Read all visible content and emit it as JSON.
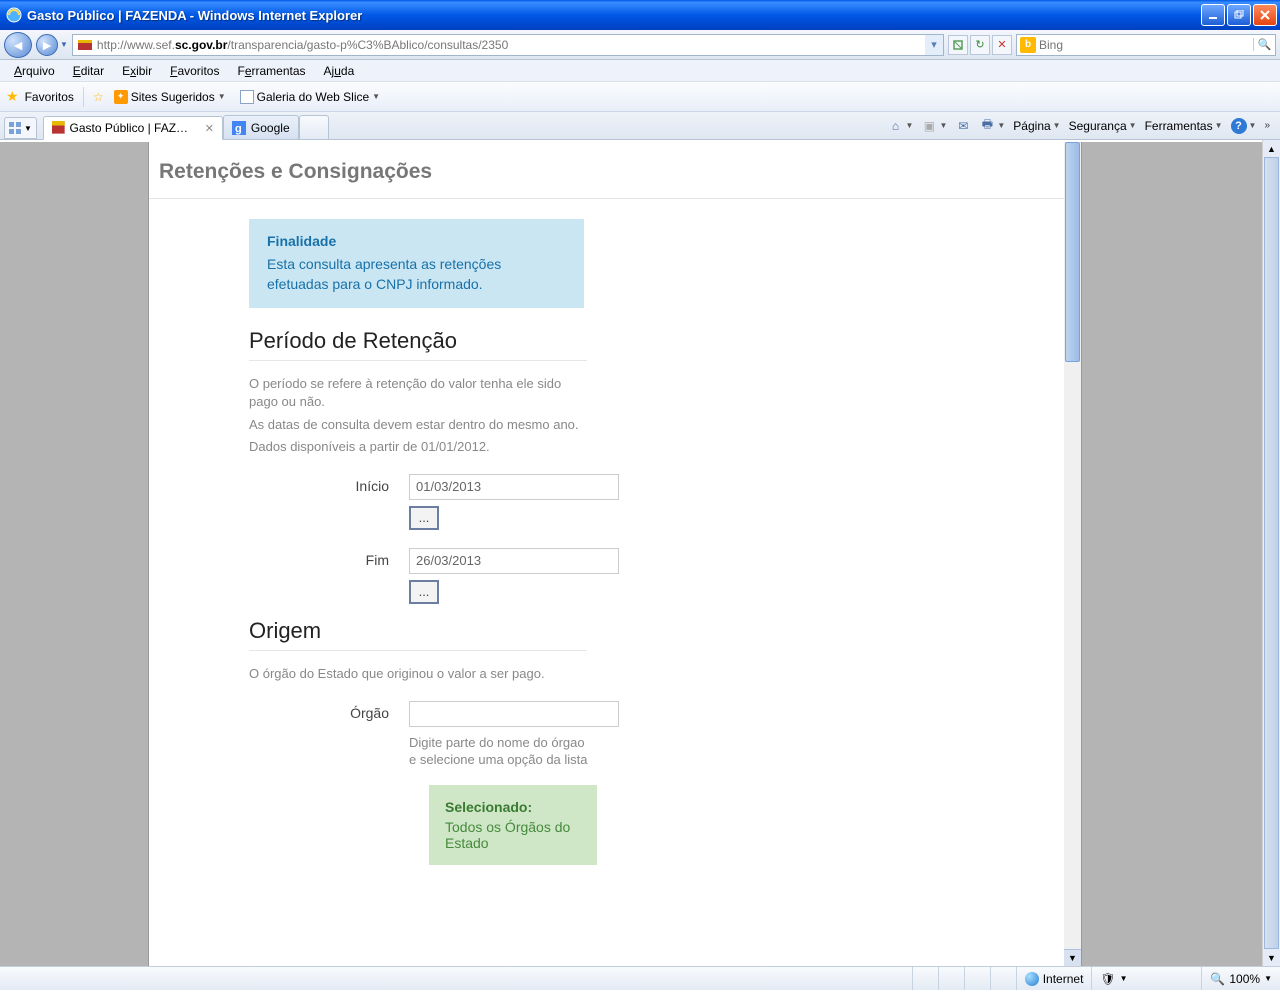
{
  "window": {
    "title": "Gasto Público | FAZENDA - Windows Internet Explorer"
  },
  "address": {
    "url_before": "http://www.sef.",
    "url_bold": "sc.gov.br",
    "url_after": "/transparencia/gasto-p%C3%BAblico/consultas/2350",
    "search_placeholder": "Bing"
  },
  "menu": {
    "arquivo": "Arquivo",
    "editar": "Editar",
    "exibir": "Exibir",
    "favoritos": "Favoritos",
    "ferramentas": "Ferramentas",
    "ajuda": "Ajuda"
  },
  "favbar": {
    "favoritos": "Favoritos",
    "sugeridos": "Sites Sugeridos",
    "galeria": "Galeria do Web Slice"
  },
  "tabs": {
    "t1": "Gasto Público | FAZENDA",
    "t2": "Google"
  },
  "commands": {
    "pagina": "Página",
    "seguranca": "Segurança",
    "ferramentas": "Ferramentas"
  },
  "page": {
    "title": "Retenções e Consignações",
    "callout_title": "Finalidade",
    "callout_body": "Esta consulta apresenta as retenções efetuadas para o CNPJ informado.",
    "periodo_heading": "Período de Retenção",
    "periodo_help1": "O período se refere à retenção do valor tenha ele sido pago ou não.",
    "periodo_help2": "As datas de consulta devem estar dentro do mesmo ano.",
    "periodo_help3": "Dados disponíveis a partir de 01/01/2012.",
    "inicio_label": "Início",
    "inicio_value": "01/03/2013",
    "fim_label": "Fim",
    "fim_value": "26/03/2013",
    "dots_label": "...",
    "origem_heading": "Origem",
    "origem_help": "O órgão do Estado que originou o valor a ser pago.",
    "orgao_label": "Órgão",
    "orgao_hint1": "Digite parte do nome do órgao",
    "orgao_hint2": "e selecione uma opção da lista",
    "selecionado_label": "Selecionado:",
    "selecionado_value": "Todos os Órgãos do Estado"
  },
  "status": {
    "zone": "Internet",
    "zoom": "100%"
  }
}
